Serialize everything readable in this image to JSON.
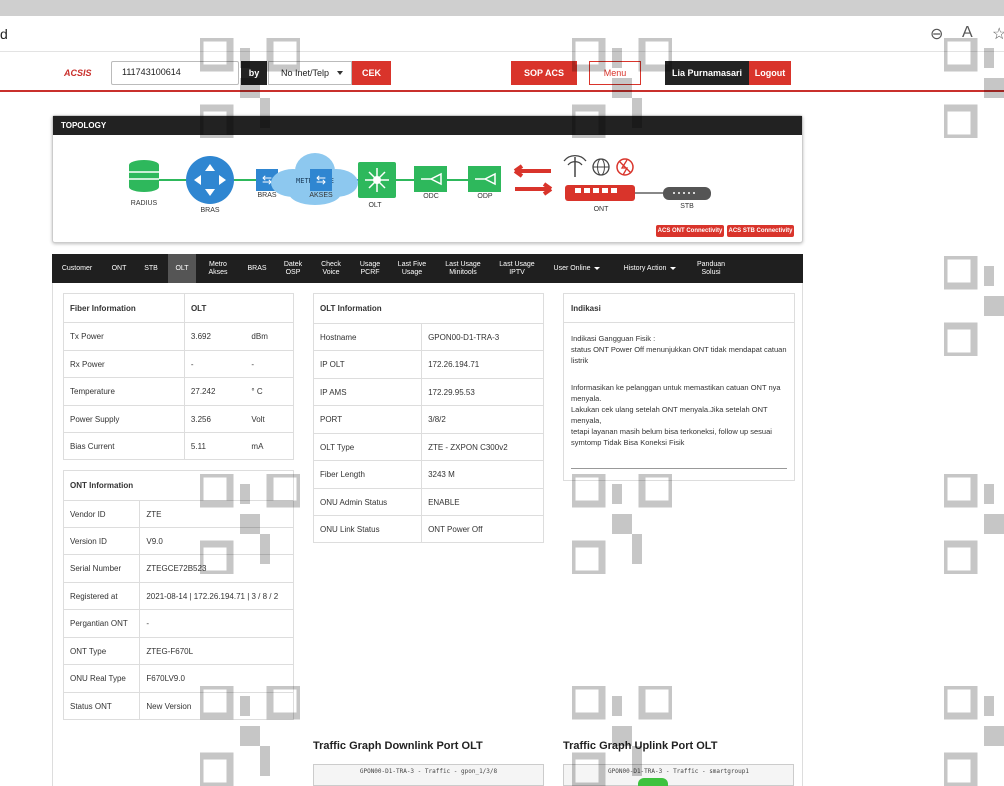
{
  "browser": {
    "url_fragment": "d"
  },
  "header": {
    "logo": "ACSIS",
    "search_value": "111743100614",
    "by_label": "by",
    "search_type": "No Inet/Telp",
    "cek_label": "CEK",
    "sop_label": "SOP ACS",
    "menu_label": "Menu",
    "user_name": "Lia Purnamasari",
    "logout_label": "Logout"
  },
  "topology": {
    "title": "TOPOLOGY",
    "nodes": {
      "radius": "RADIUS",
      "bras": "BRAS",
      "bras2": "BRAS",
      "metro": "METRO - E",
      "akses": "AKSES",
      "olt": "OLT",
      "odc": "ODC",
      "odp": "ODP",
      "ont": "ONT",
      "stb": "STB"
    },
    "buttons": {
      "ont_conn": "ACS ONT Connectivity",
      "stb_conn": "ACS STB Connectivity"
    }
  },
  "tabs": [
    {
      "label": "Customer"
    },
    {
      "label": "ONT"
    },
    {
      "label": "STB"
    },
    {
      "label": "OLT"
    },
    {
      "label": "Metro Akses"
    },
    {
      "label": "BRAS"
    },
    {
      "label": "Datek OSP"
    },
    {
      "label": "Check Voice"
    },
    {
      "label": "Usage PCRF"
    },
    {
      "label": "Last Five Usage"
    },
    {
      "label": "Last Usage Minitools"
    },
    {
      "label": "Last Usage IPTV"
    },
    {
      "label": "User Online"
    },
    {
      "label": "History Action"
    },
    {
      "label": "Panduan Solusi"
    }
  ],
  "fiber": {
    "header": [
      "Fiber Information",
      "OLT"
    ],
    "rows": [
      [
        "Tx Power",
        "3.692",
        "dBm"
      ],
      [
        "Rx Power",
        "-",
        "-"
      ],
      [
        "Temperature",
        "27.242",
        "° C"
      ],
      [
        "Power Supply",
        "3.256",
        "Volt"
      ],
      [
        "Bias Current",
        "5.11",
        "mA"
      ]
    ]
  },
  "ont_info": {
    "header": "ONT Information",
    "rows": [
      [
        "Vendor ID",
        "ZTE"
      ],
      [
        "Version ID",
        "V9.0"
      ],
      [
        "Serial Number",
        "ZTEGCE72B523"
      ],
      [
        "Registered at",
        "2021-08-14 | 172.26.194.71 | 3 / 8 / 2"
      ],
      [
        "Pergantian ONT",
        "-"
      ],
      [
        "ONT Type",
        "ZTEG-F670L"
      ],
      [
        "ONU Real Type",
        "F670LV9.0"
      ],
      [
        "Status ONT",
        "New Version"
      ]
    ]
  },
  "olt_info": {
    "header": "OLT Information",
    "rows": [
      [
        "Hostname",
        "GPON00-D1-TRA-3"
      ],
      [
        "IP OLT",
        "172.26.194.71"
      ],
      [
        "IP AMS",
        "172.29.95.53"
      ],
      [
        "PORT",
        "3/8/2"
      ],
      [
        "OLT Type",
        "ZTE - ZXPON C300v2"
      ],
      [
        "Fiber Length",
        "3243 M"
      ],
      [
        "ONU Admin Status",
        "ENABLE"
      ],
      [
        "ONU Link Status",
        "ONT Power Off"
      ]
    ]
  },
  "indikasi": {
    "header": "Indikasi",
    "line1": "Indikasi Gangguan Fisik :",
    "line2": "status ONT Power Off menunjukkan ONT tidak mendapat catuan listrik",
    "line3": "Informasikan ke pelanggan untuk memastikan catuan ONT nya menyala.",
    "line4": "Lakukan cek ulang setelah ONT menyala.Jika setelah ONT menyala,",
    "line5": "tetapi layanan masih belum bisa terkoneksi, follow up sesuai symtomp Tidak Bisa Koneksi Fisik"
  },
  "graphs": {
    "downlink_title": "Traffic Graph Downlink Port OLT",
    "uplink_title": "Traffic Graph Uplink Port OLT",
    "downlink_caption": "GPON00-D1-TRA-3 - Traffic - gpon_1/3/8",
    "uplink_caption": "GPON00-D1-TRA-3 - Traffic - smartgroup1"
  },
  "colors": {
    "accent": "#d9342b",
    "dark": "#1f1f1f",
    "green": "#2eb85c",
    "blue": "#2f86d1"
  }
}
